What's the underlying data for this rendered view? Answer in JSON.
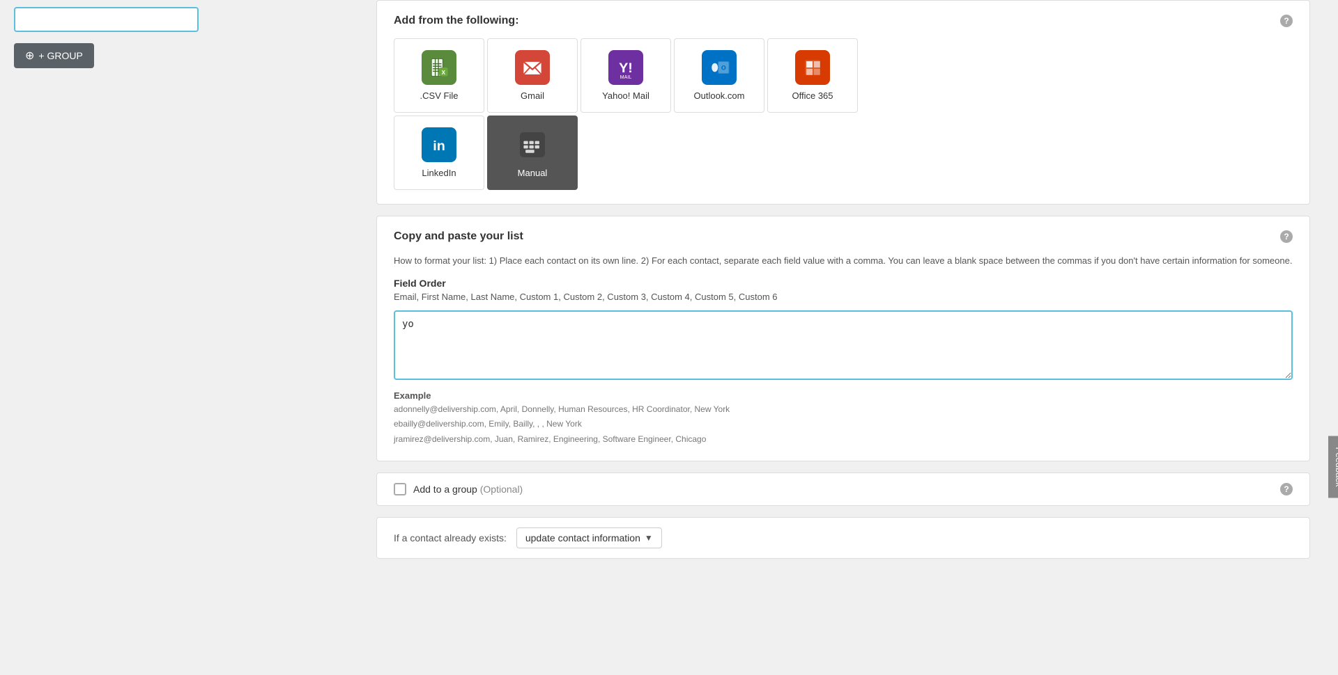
{
  "leftPanel": {
    "groupButton": "+ GROUP"
  },
  "addFromSection": {
    "title": "Add from the following:",
    "helpIcon": "?",
    "sources": [
      {
        "id": "csv",
        "label": ".CSV File",
        "iconType": "csv"
      },
      {
        "id": "gmail",
        "label": "Gmail",
        "iconType": "gmail"
      },
      {
        "id": "yahoo",
        "label": "Yahoo! Mail",
        "iconType": "yahoo"
      },
      {
        "id": "outlook",
        "label": "Outlook.com",
        "iconType": "outlook"
      },
      {
        "id": "office365",
        "label": "Office 365",
        "iconType": "office365"
      },
      {
        "id": "linkedin",
        "label": "LinkedIn",
        "iconType": "linkedin"
      },
      {
        "id": "manual",
        "label": "Manual",
        "iconType": "manual",
        "active": true
      }
    ]
  },
  "copyPasteSection": {
    "title": "Copy and paste your list",
    "helpIcon": "?",
    "description": "How to format your list: 1) Place each contact on its own line. 2) For each contact, separate each field value with a comma. You can leave a blank space between the commas if you don't have certain information for someone.",
    "fieldOrderLabel": "Field Order",
    "fieldOrderValue": "Email, First Name, Last Name, Custom 1, Custom 2, Custom 3, Custom 4, Custom 5, Custom 6",
    "textareaValue": "yo",
    "textareaPlaceholder": "",
    "exampleLabel": "Example",
    "exampleLines": [
      "adonnelly@delivership.com, April, Donnelly, Human Resources, HR Coordinator, New York",
      "ebailly@delivership.com, Emily, Bailly, , , New York",
      "jramirez@delivership.com, Juan, Ramirez, Engineering, Software Engineer, Chicago"
    ]
  },
  "addGroupSection": {
    "label": "Add to a group",
    "optional": "(Optional)",
    "helpIcon": "?"
  },
  "ifContactSection": {
    "label": "If a contact already exists:",
    "dropdownValue": "update contact information",
    "dropdownArrow": "▼"
  },
  "feedbackTab": "Feedback"
}
